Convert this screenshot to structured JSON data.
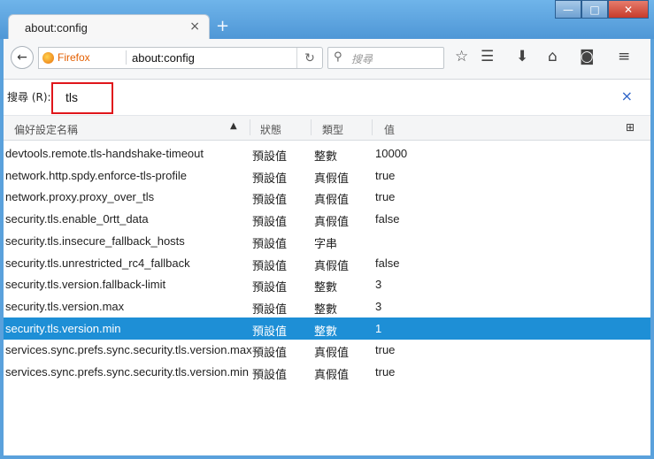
{
  "window": {
    "title": "about:config",
    "min": "—",
    "max": "□",
    "close": "✕"
  },
  "tab": {
    "title": "about:config",
    "close": "×",
    "new_tab": "+"
  },
  "nav": {
    "back_icon": "arrow-left-icon",
    "identity_label": "Firefox",
    "url": "about:config",
    "reload_icon": "reload-icon",
    "search_placeholder": "搜尋"
  },
  "find": {
    "label": "搜尋 (R):",
    "value": "tls",
    "clear": "×"
  },
  "columns": {
    "name": "偏好設定名稱",
    "status": "狀態",
    "type": "類型",
    "value": "值"
  },
  "rows": [
    {
      "name": "devtools.remote.tls-handshake-timeout",
      "status": "預設值",
      "type": "整數",
      "value": "10000"
    },
    {
      "name": "network.http.spdy.enforce-tls-profile",
      "status": "預設值",
      "type": "真假值",
      "value": "true"
    },
    {
      "name": "network.proxy.proxy_over_tls",
      "status": "預設值",
      "type": "真假值",
      "value": "true"
    },
    {
      "name": "security.tls.enable_0rtt_data",
      "status": "預設值",
      "type": "真假值",
      "value": "false"
    },
    {
      "name": "security.tls.insecure_fallback_hosts",
      "status": "預設值",
      "type": "字串",
      "value": ""
    },
    {
      "name": "security.tls.unrestricted_rc4_fallback",
      "status": "預設值",
      "type": "真假值",
      "value": "false"
    },
    {
      "name": "security.tls.version.fallback-limit",
      "status": "預設值",
      "type": "整數",
      "value": "3"
    },
    {
      "name": "security.tls.version.max",
      "status": "預設值",
      "type": "整數",
      "value": "3"
    },
    {
      "name": "security.tls.version.min",
      "status": "預設值",
      "type": "整數",
      "value": "1"
    },
    {
      "name": "services.sync.prefs.sync.security.tls.version.max",
      "status": "預設值",
      "type": "真假值",
      "value": "true"
    },
    {
      "name": "services.sync.prefs.sync.security.tls.version.min",
      "status": "預設值",
      "type": "真假值",
      "value": "true"
    }
  ],
  "selected_row": 8
}
